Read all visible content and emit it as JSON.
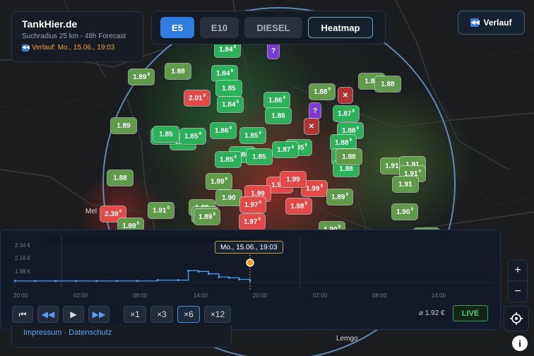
{
  "app": {
    "title": "TankHier.de",
    "subtitle": "Suchradius 25 km - 48h Forecast",
    "history_label": "Verlauf: Mo., 15.06., 19:03"
  },
  "fuel_tabs": [
    "E5",
    "E10",
    "DIESEL"
  ],
  "heatmap_label": "Heatmap",
  "verlauf_button": "Verlauf",
  "map": {
    "towns": [
      {
        "name": "Mel"
      },
      {
        "name": "Lemgo"
      }
    ],
    "markers": [
      {
        "price": "1.84",
        "sup": "9",
        "kind": "g"
      },
      {
        "price": "1.89",
        "sup": "9",
        "kind": "lg"
      },
      {
        "price": "1.88",
        "sup": "",
        "kind": "lg"
      },
      {
        "price": "1.84",
        "sup": "9",
        "kind": "g"
      },
      {
        "price": "1.85",
        "sup": "",
        "kind": "g"
      },
      {
        "price": "1.84",
        "sup": "9",
        "kind": "g"
      },
      {
        "price": "2.01",
        "sup": "9",
        "kind": "r"
      },
      {
        "price": "1.86",
        "sup": "9",
        "kind": "g"
      },
      {
        "price": "1.86",
        "sup": "",
        "kind": "g"
      },
      {
        "price": "1.88",
        "sup": "9",
        "kind": "lg"
      },
      {
        "price": "1.88",
        "sup": "",
        "kind": "lg"
      },
      {
        "price": "1.88",
        "sup": "",
        "kind": "lg"
      },
      {
        "price": "1.87",
        "sup": "9",
        "kind": "g"
      },
      {
        "price": "1.89",
        "sup": "",
        "kind": "lg"
      },
      {
        "price": "1.86",
        "sup": "9",
        "kind": "g"
      },
      {
        "price": "1.85",
        "sup": "4",
        "kind": "g"
      },
      {
        "price": "1.85",
        "sup": "9",
        "kind": "g"
      },
      {
        "price": "1.86",
        "sup": "9",
        "kind": "g"
      },
      {
        "price": "1.85",
        "sup": "",
        "kind": "g"
      },
      {
        "price": "1.88",
        "sup": "9",
        "kind": "g"
      },
      {
        "price": "1.85",
        "sup": "9",
        "kind": "g"
      },
      {
        "price": "1.86",
        "sup": "",
        "kind": "g"
      },
      {
        "price": "1.85",
        "sup": "9",
        "kind": "g"
      },
      {
        "price": "1.85",
        "sup": "",
        "kind": "g"
      },
      {
        "price": "1.85",
        "sup": "9",
        "kind": "g"
      },
      {
        "price": "1.87",
        "sup": "9",
        "kind": "g"
      },
      {
        "price": "1.88",
        "sup": "9",
        "kind": "g"
      },
      {
        "price": "1.88",
        "sup": "",
        "kind": "g"
      },
      {
        "price": "1.88",
        "sup": "",
        "kind": "g"
      },
      {
        "price": "1.88",
        "sup": "",
        "kind": "lg"
      },
      {
        "price": "1.91",
        "sup": "9",
        "kind": "lg"
      },
      {
        "price": "1.91",
        "sup": "",
        "kind": "lg"
      },
      {
        "price": "1.91",
        "sup": "4",
        "kind": "lg"
      },
      {
        "price": "1.91",
        "sup": "",
        "kind": "lg"
      },
      {
        "price": "1.88",
        "sup": "",
        "kind": "lg"
      },
      {
        "price": "1.89",
        "sup": "9",
        "kind": "lg"
      },
      {
        "price": "1.90",
        "sup": "",
        "kind": "lg"
      },
      {
        "price": "1.97",
        "sup": "9",
        "kind": "r"
      },
      {
        "price": "1.99",
        "sup": "",
        "kind": "r"
      },
      {
        "price": "1.99",
        "sup": "9",
        "kind": "r"
      },
      {
        "price": "1.99",
        "sup": "",
        "kind": "r"
      },
      {
        "price": "1.97",
        "sup": "9",
        "kind": "r"
      },
      {
        "price": "1.98",
        "sup": "9",
        "kind": "r"
      },
      {
        "price": "1.97",
        "sup": "9",
        "kind": "r"
      },
      {
        "price": "1.89",
        "sup": "9",
        "kind": "lg"
      },
      {
        "price": "1.89",
        "sup": "",
        "kind": "lg"
      },
      {
        "price": "1.89",
        "sup": "9",
        "kind": "lg"
      },
      {
        "price": "1.91",
        "sup": "9",
        "kind": "lg"
      },
      {
        "price": "1.90",
        "sup": "9",
        "kind": "lg"
      },
      {
        "price": "1.89",
        "sup": "9",
        "kind": "lg"
      },
      {
        "price": "2.39",
        "sup": "9",
        "kind": "r"
      },
      {
        "price": "1.89",
        "sup": "9",
        "kind": "lg"
      },
      {
        "price": "1.90",
        "sup": "9",
        "kind": "lg"
      },
      {
        "price": "1.90",
        "sup": "",
        "kind": "lg"
      }
    ],
    "unknown_marker": "?",
    "closed_marker": "✕"
  },
  "timeline": {
    "y_ticks": [
      "2.34 €",
      "2.16 €",
      "1.98 €"
    ],
    "x_ticks": [
      "20:00",
      "02:00",
      "08:00",
      "14:00",
      "20:00",
      "02:00",
      "08:00",
      "14:00"
    ],
    "tooltip": "Mo., 15.06., 19:03",
    "speeds": [
      "×1",
      "×3",
      "×6",
      "×12"
    ],
    "active_speed": "×6",
    "average": "⌀ 1.92 €",
    "live": "LIVE",
    "chart_data": {
      "type": "line",
      "x": [
        "20:00",
        "22:00",
        "00:00",
        "02:00",
        "04:00",
        "06:00",
        "08:00",
        "10:00",
        "12:00",
        "13:00",
        "14:00",
        "15:00",
        "16:00",
        "17:00",
        "18:00",
        "19:03"
      ],
      "values": [
        1.92,
        1.92,
        1.92,
        1.92,
        1.92,
        1.92,
        1.92,
        1.93,
        1.93,
        2.05,
        2.04,
        2.01,
        1.97,
        1.96,
        1.94,
        1.92
      ],
      "ylim": [
        1.9,
        2.4
      ],
      "color": "#4a9af0"
    }
  },
  "links": "Impressum · Datenschutz",
  "zoom": {
    "in": "+",
    "out": "−"
  },
  "info_icon": "i"
}
